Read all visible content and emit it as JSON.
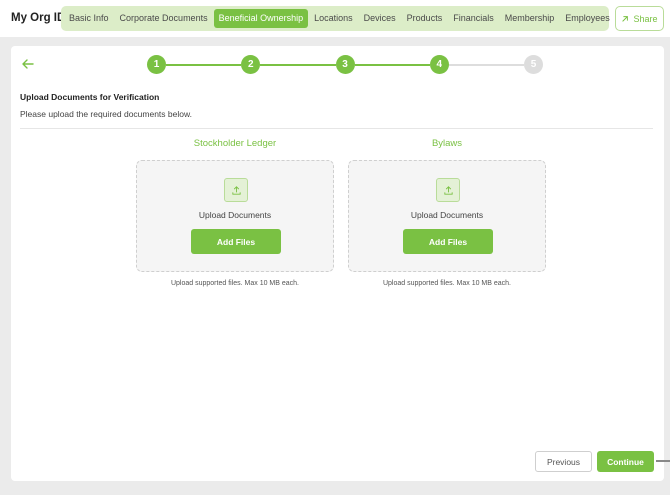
{
  "header": {
    "app_title": "My Org ID",
    "tabs": [
      {
        "label": "Basic Info",
        "active": false
      },
      {
        "label": "Corporate Documents",
        "active": false
      },
      {
        "label": "Beneficial Ownership",
        "active": true
      },
      {
        "label": "Locations",
        "active": false
      },
      {
        "label": "Devices",
        "active": false
      },
      {
        "label": "Products",
        "active": false
      },
      {
        "label": "Financials",
        "active": false
      },
      {
        "label": "Membership",
        "active": false
      },
      {
        "label": "Employees",
        "active": false
      }
    ],
    "share_label": "Share"
  },
  "stepper": {
    "steps": [
      {
        "label": "1",
        "state": "complete"
      },
      {
        "label": "2",
        "state": "complete"
      },
      {
        "label": "3",
        "state": "complete"
      },
      {
        "label": "4",
        "state": "current"
      },
      {
        "label": "5",
        "state": "upcoming"
      }
    ]
  },
  "section": {
    "title": "Upload Documents for Verification",
    "description": "Please upload the required documents below."
  },
  "uploads": [
    {
      "heading": "Stockholder Ledger",
      "dropzone_text": "Upload Documents",
      "button_label": "Add Files",
      "note": "Upload supported files. Max 10 MB each."
    },
    {
      "heading": "Bylaws",
      "dropzone_text": "Upload Documents",
      "button_label": "Add Files",
      "note": "Upload supported files. Max 10 MB each."
    }
  ],
  "footer": {
    "previous_label": "Previous",
    "continue_label": "Continue"
  },
  "colors": {
    "accent": "#7ac143",
    "accent_light": "#dcedc8",
    "step_upcoming": "#dddddd"
  }
}
